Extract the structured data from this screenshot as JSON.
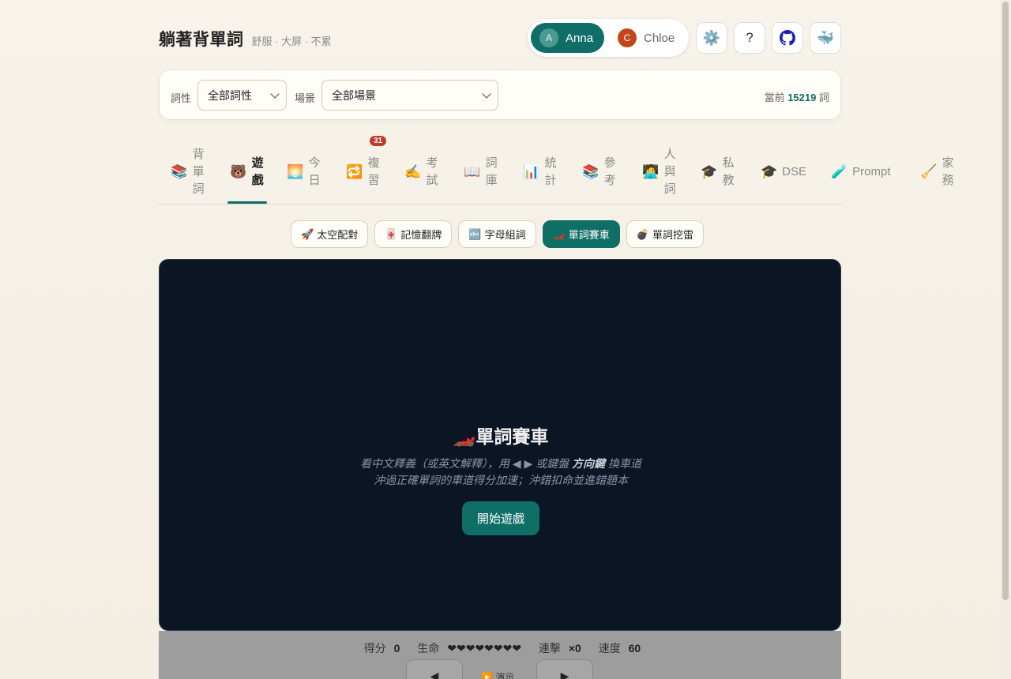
{
  "brand": {
    "title": "躺著背單詞",
    "subtitle": "舒服 · 大屏 · 不累"
  },
  "users": [
    {
      "initial": "A",
      "name": "Anna",
      "active": true
    },
    {
      "initial": "C",
      "name": "Chloe",
      "active": false
    }
  ],
  "toolbar": {
    "settings": "⚙️",
    "help": "?",
    "github": "github-icon",
    "docker": "🐳"
  },
  "filters": {
    "pos_label": "詞性",
    "pos_value": "全部詞性",
    "scene_label": "場景",
    "scene_value": "全部場景",
    "count_prefix": "當前",
    "count_value": "15219",
    "count_suffix": "詞"
  },
  "tabs": [
    {
      "emoji": "📚",
      "label": "背單詞",
      "active": false
    },
    {
      "emoji": "🐻",
      "label": "遊戲",
      "active": true
    },
    {
      "emoji": "🌅",
      "label": "今日",
      "active": false
    },
    {
      "emoji": "🔁",
      "label": "複習",
      "active": false,
      "badge": "31"
    },
    {
      "emoji": "✍️",
      "label": "考試",
      "active": false
    },
    {
      "emoji": "📖",
      "label": "詞庫",
      "active": false
    },
    {
      "emoji": "📊",
      "label": "統計",
      "active": false
    },
    {
      "emoji": "📚",
      "label": "參考",
      "active": false
    },
    {
      "emoji": "🧑‍💻",
      "label": "人與詞",
      "active": false
    },
    {
      "emoji": "🎓",
      "label": "私教",
      "active": false
    },
    {
      "emoji": "🎓",
      "label": "DSE",
      "active": false
    },
    {
      "emoji": "🧪",
      "label": "Prompt",
      "active": false
    },
    {
      "emoji": "🧹",
      "label": "家務",
      "active": false
    }
  ],
  "games": [
    {
      "emoji": "🚀",
      "label": "太空配對",
      "active": false
    },
    {
      "emoji": "🀄",
      "label": "記憶翻牌",
      "active": false
    },
    {
      "emoji": "🔤",
      "label": "字母組詞",
      "active": false
    },
    {
      "emoji": "🏎️",
      "label": "單詞賽車",
      "active": true
    },
    {
      "emoji": "💣",
      "label": "單詞挖雷",
      "active": false
    }
  ],
  "board": {
    "title_emoji": "🏎️",
    "title": "單詞賽車",
    "line1_a": "看中文釋義（或英文解釋），用 ◀ ▶ 或鍵盤 ",
    "line1_b": "方向鍵",
    "line1_c": " 換車道",
    "line2": "沖過正確單詞的車道得分加速；沖錯扣命並進錯題本",
    "start_label": "開始遊戲"
  },
  "stats": {
    "score_label": "得分",
    "score": "0",
    "life_label": "生命",
    "life": "❤❤❤❤❤❤❤❤",
    "combo_label": "連擊",
    "combo": "×0",
    "speed_label": "速度",
    "speed": "60",
    "left": "◀",
    "right": "▶",
    "demo": "▶️ 演示"
  }
}
